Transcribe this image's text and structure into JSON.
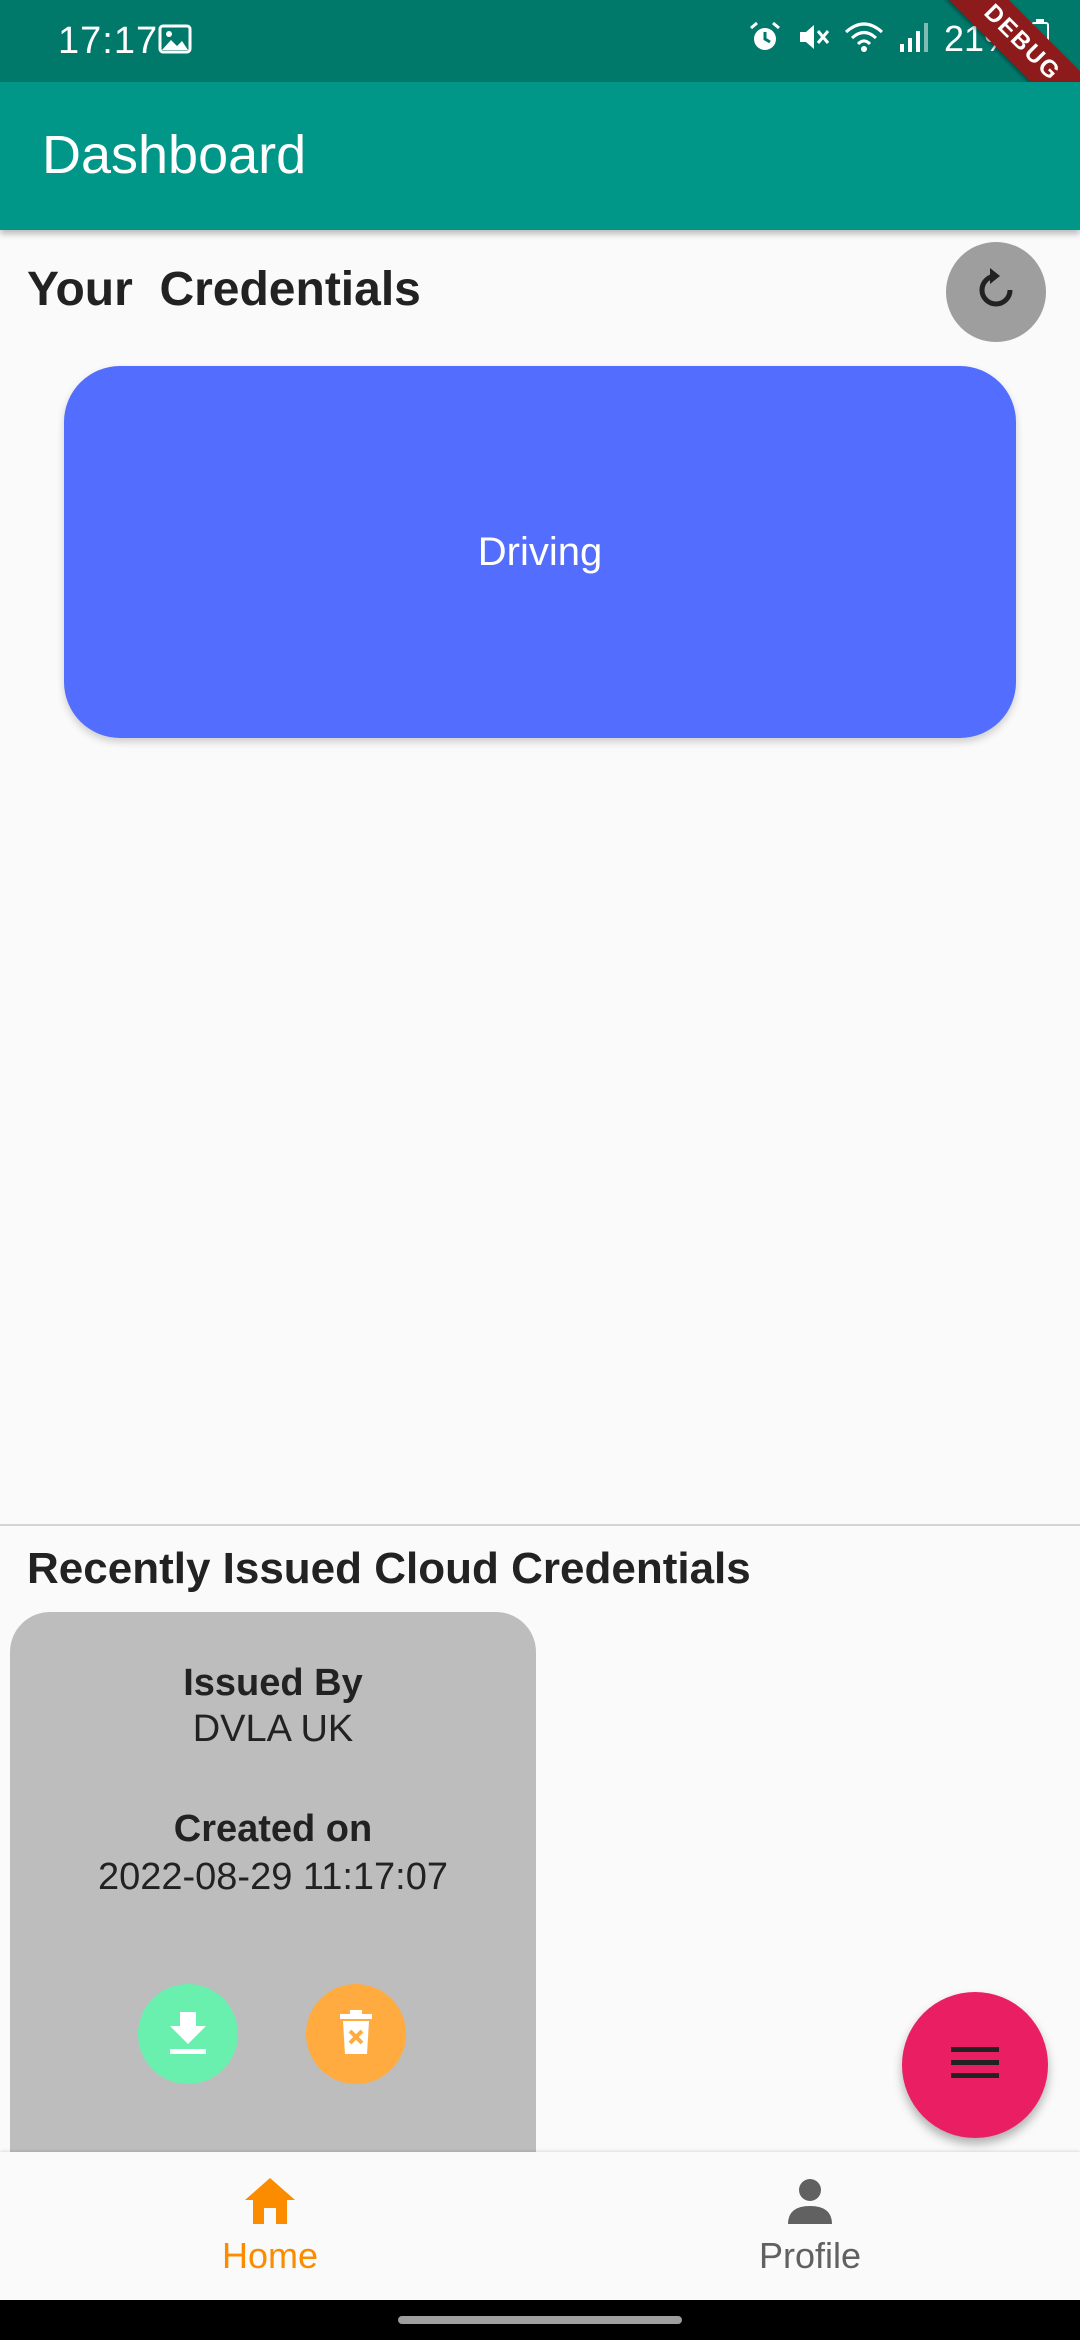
{
  "status_bar": {
    "time": "17:17",
    "battery": "21%",
    "icons": [
      "image-icon",
      "alarm-icon",
      "mute-icon",
      "wifi-icon",
      "signal-icon",
      "battery-icon"
    ]
  },
  "debug_banner": "DEBUG",
  "app_bar": {
    "title": "Dashboard"
  },
  "credentials_section": {
    "title": "Your  Credentials",
    "cards": [
      {
        "label": "Driving",
        "color": "#536dfe"
      }
    ]
  },
  "cloud_section": {
    "title": "Recently Issued Cloud Credentials",
    "card": {
      "issued_by_label": "Issued By",
      "issued_by_value": "DVLA UK",
      "created_on_label": "Created on",
      "created_on_value": "2022-08-29 11:17:07",
      "download_color": "#69f0ae",
      "delete_color": "#ffab40"
    }
  },
  "bottom_nav": {
    "items": [
      {
        "label": "Home",
        "icon": "home-icon",
        "active": true
      },
      {
        "label": "Profile",
        "icon": "person-icon",
        "active": false
      }
    ],
    "active_color": "#fb8c00",
    "inactive_color": "#616161"
  },
  "colors": {
    "status_bar": "#00796b",
    "app_bar": "#009688",
    "fab": "#e91e63"
  }
}
